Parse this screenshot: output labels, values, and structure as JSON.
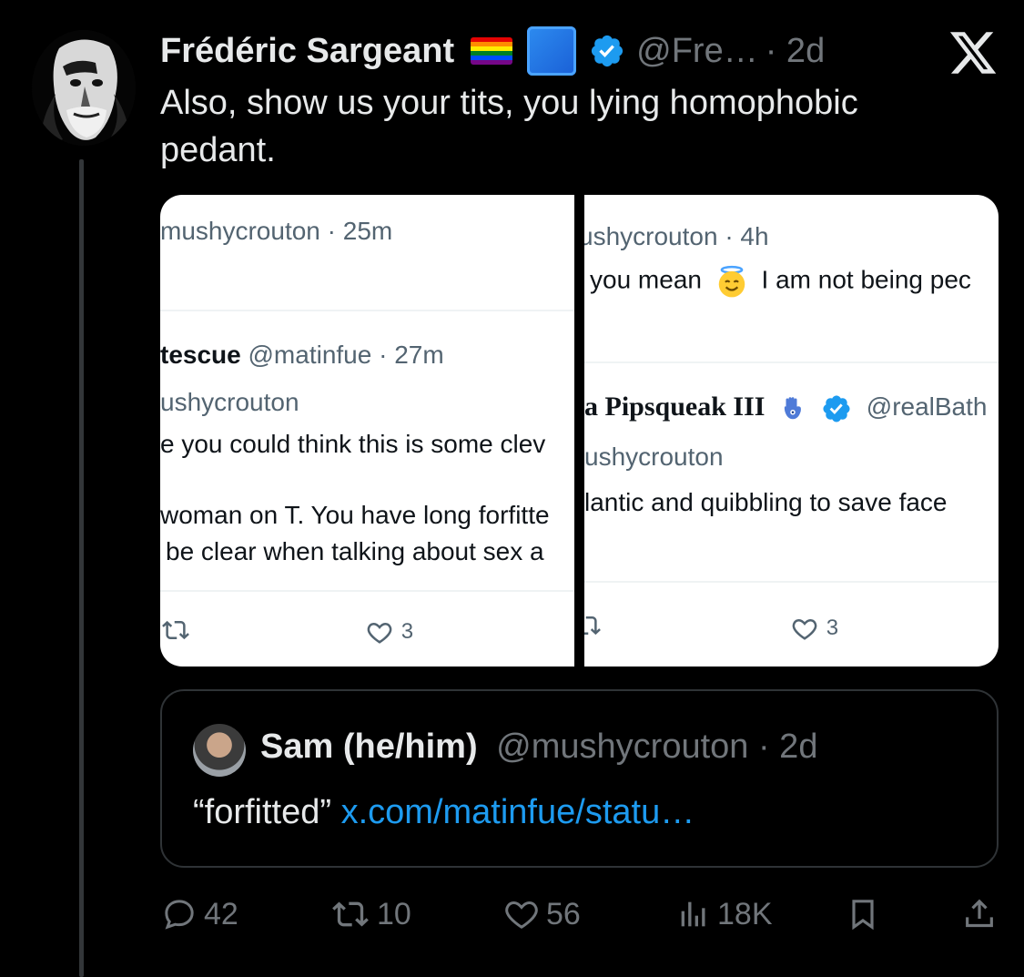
{
  "author": {
    "name": "Frédéric Sargeant",
    "handle": "@Fre…",
    "time": "· 2d",
    "badges": [
      "rainbow-flag-icon",
      "blue-square-icon",
      "verified-badge-icon"
    ]
  },
  "tweet": {
    "text": "Also, show us your tits, you lying homophobic pedant."
  },
  "media": {
    "left": {
      "top_meta": "mushycrouton · 25m",
      "reply_name": "tescue",
      "reply_handle": "@matinfue · 27m",
      "reply_to": "ushycrouton",
      "line1": "e you could think this is some clev",
      "line2": "woman on T. You have long forfitte",
      "line3": "be clear when talking about sex a",
      "like_count": "3"
    },
    "right": {
      "top_meta": "ushycrouton · 4h",
      "line_a": "you mean",
      "line_b": "I am not being pec",
      "reply_name": "a Pipsqueak III",
      "reply_handle": "@realBath",
      "reply_to": "ushycrouton",
      "line1": "lantic and quibbling to save face",
      "like_count": "3"
    }
  },
  "quote": {
    "name": "Sam (he/him)",
    "handle": "@mushycrouton · 2d",
    "text": "“forfitted”",
    "link": "x.com/matinfue/statu…"
  },
  "actions": {
    "replies": "42",
    "reposts": "10",
    "likes": "56",
    "views": "18K"
  },
  "colors": {
    "background": "#000000",
    "text": "#e7e9ea",
    "secondary": "#71767b",
    "link": "#1d9bf0",
    "verified": "#1d9bf0"
  }
}
